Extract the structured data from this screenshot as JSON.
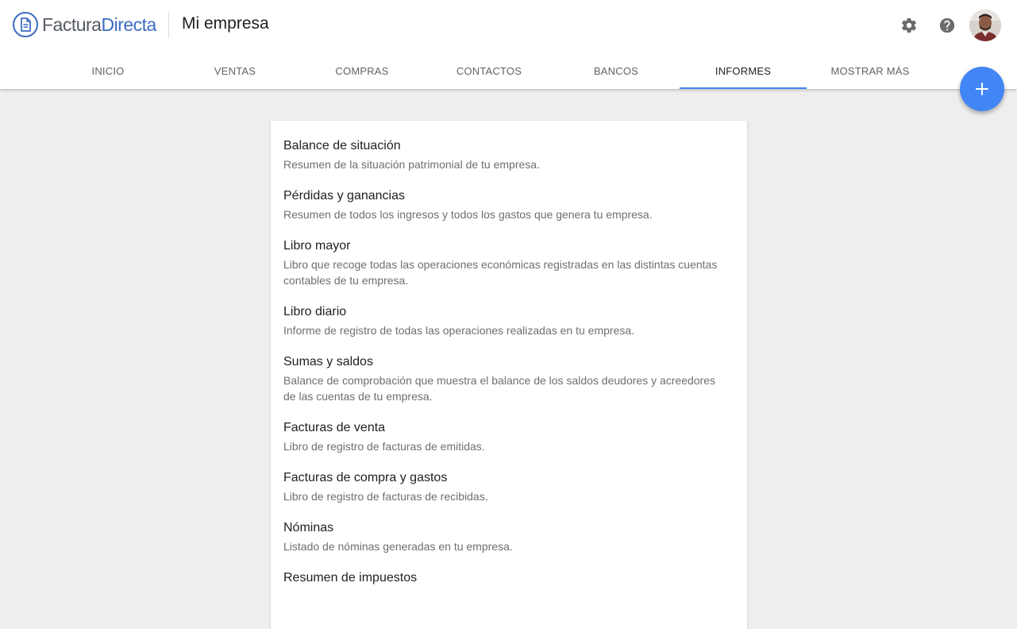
{
  "app": {
    "brand_part1": "Factura",
    "brand_part2": "Directa",
    "company": "Mi empresa",
    "brand_color": "#3b6cc4",
    "accent_color": "#4285f4"
  },
  "header": {
    "icons": [
      "gear-icon",
      "help-icon",
      "avatar"
    ]
  },
  "tabs": [
    {
      "label": "INICIO",
      "active": false
    },
    {
      "label": "VENTAS",
      "active": false
    },
    {
      "label": "COMPRAS",
      "active": false
    },
    {
      "label": "CONTACTOS",
      "active": false
    },
    {
      "label": "BANCOS",
      "active": false
    },
    {
      "label": "INFORMES",
      "active": true
    },
    {
      "label": "MOSTRAR MÁS",
      "active": false
    }
  ],
  "fab": {
    "icon": "plus-icon"
  },
  "reports": [
    {
      "title": "Balance de situación",
      "desc": "Resumen de la situación patrimonial de tu empresa."
    },
    {
      "title": "Pérdidas y ganancias",
      "desc": "Resumen de todos los ingresos y todos los gastos que genera tu empresa."
    },
    {
      "title": "Libro mayor",
      "desc": "Libro que recoge todas las operaciones económicas registradas en las distintas cuentas contables de tu empresa."
    },
    {
      "title": "Libro diario",
      "desc": "Informe de registro de todas las operaciones realizadas en tu empresa."
    },
    {
      "title": "Sumas y saldos",
      "desc": "Balance de comprobación que muestra el balance de los saldos deudores y acreedores de las cuentas de tu empresa."
    },
    {
      "title": "Facturas de venta",
      "desc": "Libro de registro de facturas de emitidas."
    },
    {
      "title": "Facturas de compra y gastos",
      "desc": "Libro de registro de facturas de recibidas."
    },
    {
      "title": "Nóminas",
      "desc": "Listado de nóminas generadas en tu empresa."
    },
    {
      "title": "Resumen de impuestos",
      "desc": ""
    }
  ]
}
